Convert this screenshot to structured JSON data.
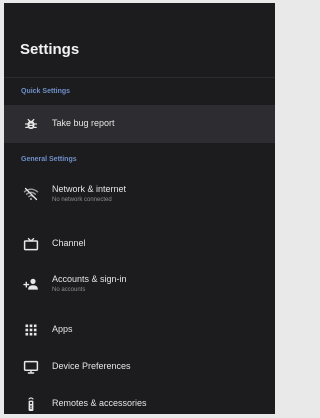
{
  "header": {
    "title": "Settings"
  },
  "sections": {
    "quick": {
      "label": "Quick Settings",
      "items": [
        {
          "label": "Take bug report",
          "icon": "bug-icon"
        }
      ]
    },
    "general": {
      "label": "General Settings",
      "items": [
        {
          "label": "Network & internet",
          "sub": "No network connected",
          "icon": "wifi-off-icon"
        },
        {
          "label": "Channel",
          "icon": "tv-icon"
        },
        {
          "label": "Accounts & sign-in",
          "sub": "No accounts",
          "icon": "add-person-icon"
        },
        {
          "label": "Apps",
          "icon": "apps-grid-icon"
        },
        {
          "label": "Device Preferences",
          "icon": "monitor-icon"
        },
        {
          "label": "Remotes & accessories",
          "icon": "remote-icon"
        }
      ]
    }
  },
  "colors": {
    "background": "#1c1c1e",
    "focused_row": "#2d2d31",
    "section_header": "#6f8fc9",
    "text_primary": "#e6e6e6",
    "text_secondary": "#8d8d8d"
  }
}
